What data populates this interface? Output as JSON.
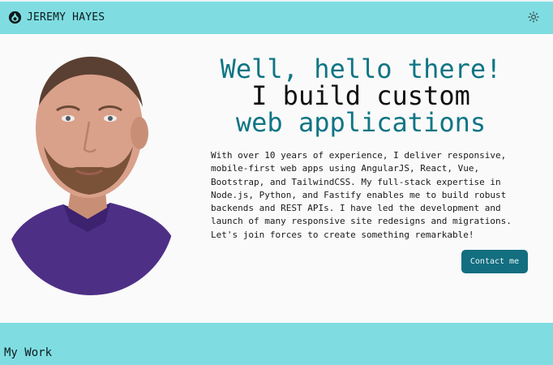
{
  "header": {
    "brand_name": "JEREMY HAYES",
    "logo_icon": "brand-logo-icon",
    "theme_icon": "sun-icon"
  },
  "hero": {
    "headline_line1": "Well, hello there!",
    "headline_line2": "I build custom",
    "headline_line3": "web applications",
    "bio": "With over 10 years of experience, I deliver responsive, mobile-first web apps using AngularJS, React, Vue, Bootstrap, and TailwindCSS. My full-stack expertise in Node.js, Python, and Fastify enables me to build robust backends and REST APIs. I have led the development and launch of many responsive site redesigns and migrations. Let's join forces to create something remarkable!",
    "contact_label": "Contact me"
  },
  "work": {
    "title": "My Work"
  },
  "colors": {
    "band": "#7fdde2",
    "accent": "#0f7584",
    "button": "#136e80",
    "background": "#fafafa"
  }
}
